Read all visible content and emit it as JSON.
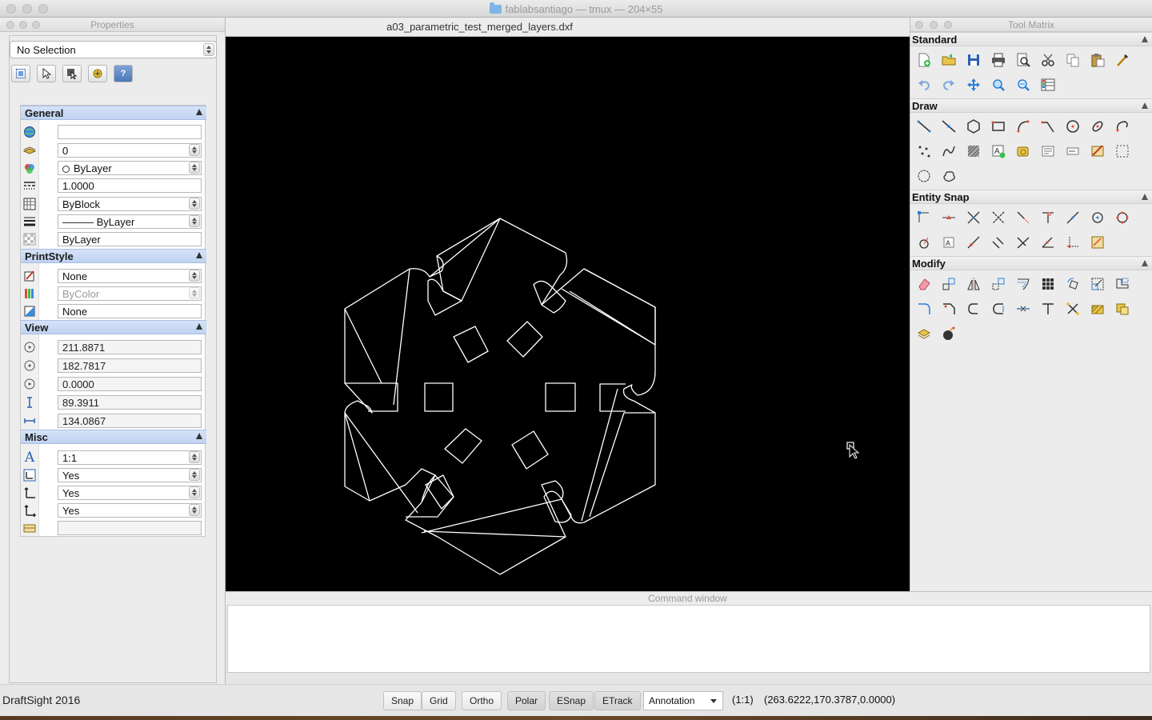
{
  "window": {
    "title": "fablabsantiago — tmux — 204×55"
  },
  "properties": {
    "panel_title": "Properties",
    "selection": "No Selection",
    "sections": {
      "general": "General",
      "printstyle": "PrintStyle",
      "view": "View",
      "misc": "Misc"
    },
    "general": {
      "color": "",
      "layer": "0",
      "linetype": "ByLayer",
      "linetype_scale": "1.0000",
      "lineweight": "ByBlock",
      "linestyle": "——— ByLayer",
      "transparency": "ByLayer"
    },
    "printstyle": {
      "print_style": "None",
      "print_table": "ByColor",
      "print_table_type": "None"
    },
    "view": {
      "center_x": "211.8871",
      "center_y": "182.7817",
      "center_z": "0.0000",
      "height": "89.3911",
      "width": "134.0867"
    },
    "misc": {
      "annotation_scale": "1:1",
      "ucs_icon_on": "Yes",
      "ucs_icon_origin": "Yes",
      "ucs_per_viewport": "Yes",
      "ucs_name": ""
    }
  },
  "document": {
    "title": "a03_parametric_test_merged_layers.dxf"
  },
  "tool_matrix": {
    "title": "Tool Matrix",
    "sections": {
      "standard": "Standard",
      "draw": "Draw",
      "entity_snap": "Entity Snap",
      "modify": "Modify"
    }
  },
  "command_window": {
    "title": "Command window"
  },
  "status": {
    "app_name": "DraftSight 2016",
    "buttons": {
      "snap": "Snap",
      "grid": "Grid",
      "ortho": "Ortho",
      "polar": "Polar",
      "esnap": "ESnap",
      "etrack": "ETrack"
    },
    "annotation": "Annotation",
    "scale": "(1:1)",
    "coordinates": "(263.6222,170.3787,0.0000)"
  },
  "colors": {
    "canvas": "#000000",
    "section_header": "#c9d9f4",
    "drawing_lines": "#ffffff"
  }
}
